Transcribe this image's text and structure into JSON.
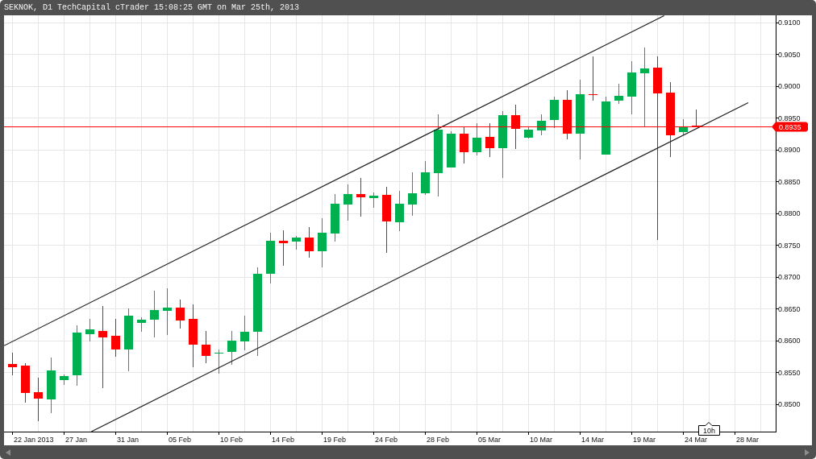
{
  "window": {
    "title": "SEKNOK, D1 TechCapital cTrader 15:08:25 GMT on Mar 25th, 2013"
  },
  "chart": {
    "y_axis_labels": [
      "0.9100",
      "0.9050",
      "0.9000",
      "0.8950",
      "0.8900",
      "0.8850",
      "0.8800",
      "0.8750",
      "0.8700",
      "0.8650",
      "0.8600",
      "0.8550",
      "0.8500"
    ],
    "x_axis_labels": [
      "22 Jan 2013",
      "27 Jan",
      "31 Jan",
      "05 Feb",
      "10 Feb",
      "14 Feb",
      "19 Feb",
      "24 Feb",
      "28 Feb",
      "05 Mar",
      "10 Mar",
      "14 Mar",
      "19 Mar",
      "24 Mar",
      "28 Mar"
    ],
    "price_tag": "0.8935",
    "bar_timer": "10h"
  }
}
